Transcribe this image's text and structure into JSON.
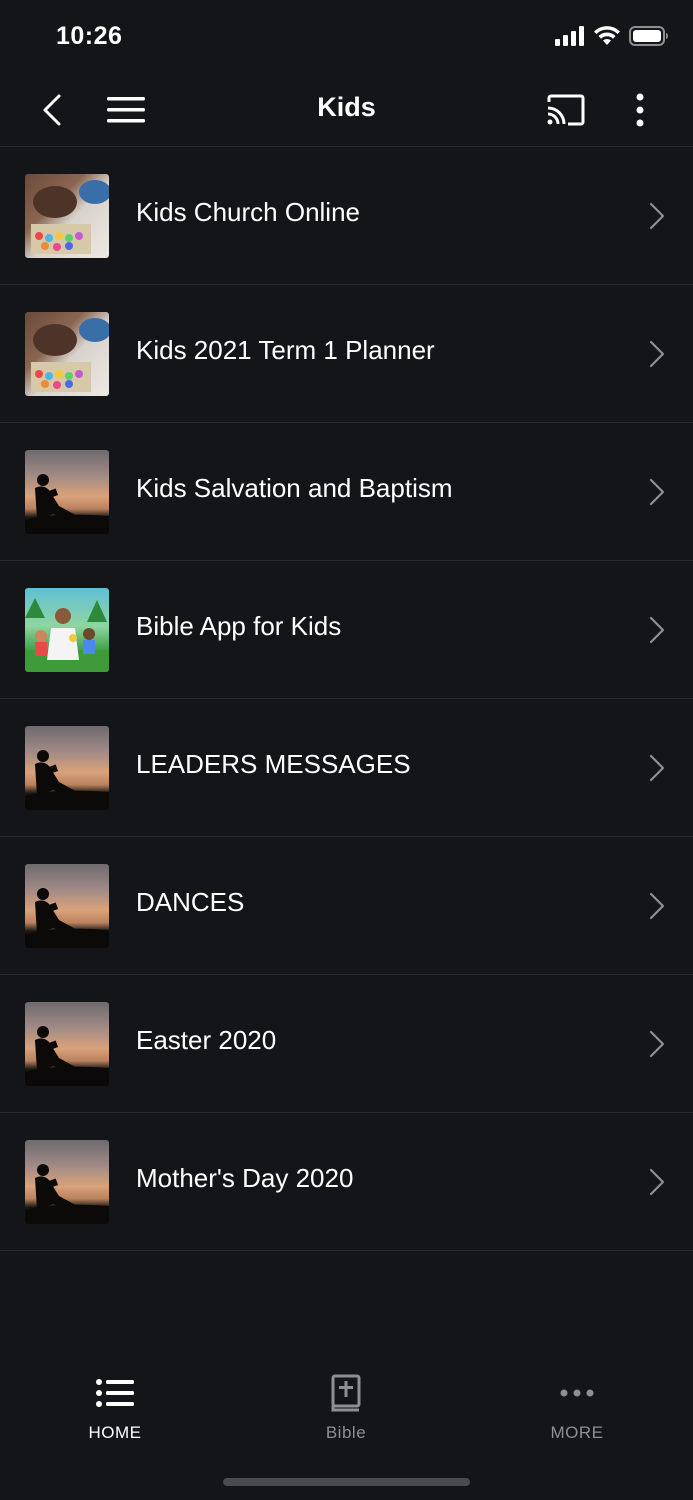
{
  "status": {
    "time": "10:26",
    "icons": [
      "signal-icon",
      "wifi-icon",
      "battery-icon"
    ]
  },
  "nav": {
    "title": "Kids",
    "icons": [
      "back-icon",
      "hamburger-menu-icon",
      "cast-icon",
      "more-vertical-icon"
    ]
  },
  "items": [
    {
      "label": "Kids Church Online",
      "thumb": "crayons-photo"
    },
    {
      "label": "Kids 2021 Term 1 Planner",
      "thumb": "crayons-photo"
    },
    {
      "label": "Kids Salvation and Baptism",
      "thumb": "sunset-reader-photo"
    },
    {
      "label": "Bible App for Kids",
      "thumb": "cartoon-kids-illustration"
    },
    {
      "label": "LEADERS MESSAGES",
      "thumb": "sunset-reader-photo"
    },
    {
      "label": "DANCES",
      "thumb": "sunset-reader-photo"
    },
    {
      "label": "Easter 2020",
      "thumb": "sunset-reader-photo"
    },
    {
      "label": "Mother's Day 2020",
      "thumb": "sunset-reader-photo"
    }
  ],
  "tabs": [
    {
      "label": "HOME",
      "icon": "list-icon",
      "active": true
    },
    {
      "label": "Bible",
      "icon": "bible-icon",
      "active": false
    },
    {
      "label": "MORE",
      "icon": "more-horizontal-icon",
      "active": false
    }
  ],
  "colors": {
    "background": "#141518",
    "divider": "#2a2b2f",
    "inactive": "#8e8f94",
    "text": "#ffffff"
  }
}
